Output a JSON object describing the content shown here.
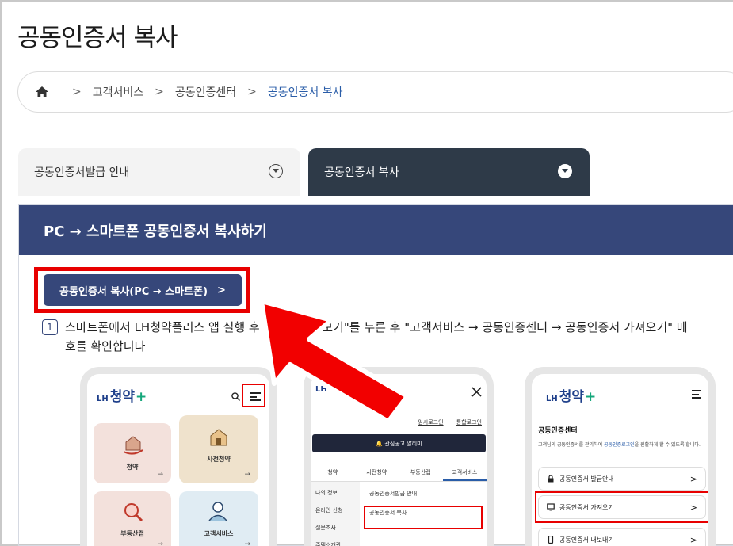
{
  "page": {
    "title": "공동인증서 복사"
  },
  "breadcrumb": {
    "home_icon": "home-icon",
    "items": [
      "고객서비스",
      "공동인증센터",
      "공동인증서 복사"
    ],
    "separator": ">"
  },
  "tabs": [
    {
      "label": "공동인증서발급 안내",
      "active": false
    },
    {
      "label": "공동인증서 복사",
      "active": true
    }
  ],
  "section": {
    "heading": "PC → 스마트폰 공동인증서 복사하기",
    "button_label": "공동인증서 복사(PC → 스마트폰)",
    "button_arrow": ">",
    "step_number": "1",
    "step_line1": "스마트폰에서 LH청약플러스 앱 실행 후 \"           \"전체메뉴보기\"를 누른 후 \"고객서비스 → 공동인증센터 → 공동인증서 가져오기\" 메",
    "step_line2": "호를 확인합니다"
  },
  "phone1": {
    "logo_prefix": "LH",
    "logo_name": "청약",
    "logo_plus": "+",
    "search_icon": "search-icon",
    "menu_icon": "menu-icon",
    "tiles": [
      "청약",
      "사전청약",
      "부동산랩",
      "고객서비스"
    ],
    "tile_arrow": "→"
  },
  "phone2": {
    "logo_prefix": "LH",
    "close_icon": "close-icon",
    "links": [
      "임시로그인",
      "통합로그인"
    ],
    "alarm_label": "🔔 관심공고 알리미",
    "menu_tabs": [
      "청약",
      "사전청약",
      "부동산랩",
      "고객서비스"
    ],
    "left_items": [
      "나의 정보",
      "온라인 신청",
      "설문조사",
      "주택소개관"
    ],
    "right_items": [
      "공동인증서발급 안내",
      "공동인증서 복사"
    ]
  },
  "phone3": {
    "logo_prefix": "LH",
    "logo_name": "청약",
    "logo_plus": "+",
    "menu_icon": "menu-icon",
    "title": "공동인증센터",
    "desc_before": "고객님의 공동인증서를 관리하여 ",
    "desc_link": "공동인증로그인",
    "desc_after": "을 원활하게 할 수 있도록 합니다.",
    "rows": [
      "공동인증서 발급안내",
      "공동인증서 가져오기",
      "공동인증서 내보내기"
    ],
    "row_arrow": ">"
  },
  "colors": {
    "navy": "#36477a",
    "dark_tab": "#2e3a48",
    "highlight": "#e80000",
    "link_blue": "#2a5da8"
  }
}
